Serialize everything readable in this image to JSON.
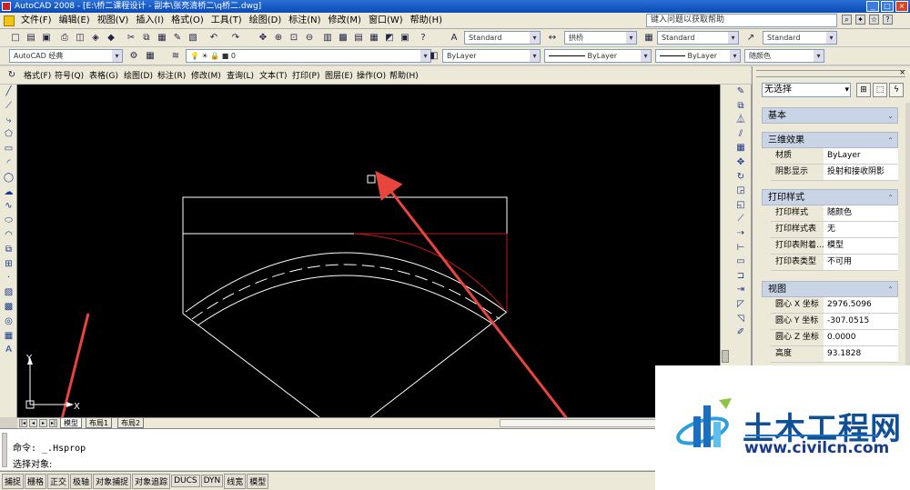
{
  "window": {
    "title": "AutoCAD 2008 - [E:\\桥二课程设计 - 副本\\张亮清桥二\\q桥二.dwg]",
    "controls": [
      "_",
      "□",
      "×"
    ]
  },
  "menu": {
    "items": [
      "文件(F)",
      "编辑(E)",
      "视图(V)",
      "插入(I)",
      "格式(O)",
      "工具(T)",
      "绘图(D)",
      "标注(N)",
      "修改(M)",
      "窗口(W)",
      "帮助(H)"
    ],
    "help_placeholder": "键入问题以获取帮助"
  },
  "toolbar1": {
    "text_style": "Standard",
    "dim_style": "拱桥",
    "table_style": "Standard",
    "multileader_style": "Standard"
  },
  "toolbar2": {
    "workspace": "AutoCAD 经典",
    "layer": "0",
    "color": "ByLayer",
    "linetype": "ByLayer",
    "lineweight": "ByLayer",
    "plotstyle": "随颜色"
  },
  "toolbar3": {
    "items": [
      "格式(F)",
      "符号(Q)",
      "表格(G)",
      "绘图(D)",
      "标注(R)",
      "修改(M)",
      "查询(L)",
      "文本(T)",
      "打印(P)",
      "图层(E)",
      "操作(O)",
      "帮助(H)"
    ]
  },
  "drawing": {
    "ucs_x": "X",
    "ucs_y": "Y",
    "colors": {
      "background": "#000000",
      "lines": "#ffffff",
      "red": "#c0181c",
      "arrow": "#e8453c"
    }
  },
  "layout_tabs": {
    "items": [
      "模型",
      "布局1",
      "布局2"
    ],
    "active": "模型"
  },
  "command": {
    "line1": "命令: _.Hsprop",
    "line2": "选择对象:"
  },
  "status_bar": {
    "items": [
      "捕捉",
      "栅格",
      "正交",
      "极轴",
      "对象捕捉",
      "对象追踪",
      "DUCS",
      "DYN",
      "线宽",
      "模型"
    ]
  },
  "properties": {
    "selection": "无选择",
    "sections": [
      {
        "title": "基本",
        "rows": []
      },
      {
        "title": "三维效果",
        "rows": [
          {
            "k": "材质",
            "v": "ByLayer"
          },
          {
            "k": "阴影显示",
            "v": "投射和接收阴影"
          }
        ]
      },
      {
        "title": "打印样式",
        "rows": [
          {
            "k": "打印样式",
            "v": "随颜色"
          },
          {
            "k": "打印样式表",
            "v": "无"
          },
          {
            "k": "打印表附着...",
            "v": "模型"
          },
          {
            "k": "打印表类型",
            "v": "不可用"
          }
        ]
      },
      {
        "title": "视图",
        "rows": [
          {
            "k": "圆心 X 坐标",
            "v": "2976.5096"
          },
          {
            "k": "圆心 Y 坐标",
            "v": "-307.0515"
          },
          {
            "k": "圆心 Z 坐标",
            "v": "0.0000"
          },
          {
            "k": "高度",
            "v": "93.1828"
          }
        ]
      }
    ]
  },
  "watermark": {
    "title": "土木工程网",
    "url": "www.civilcn.com"
  }
}
